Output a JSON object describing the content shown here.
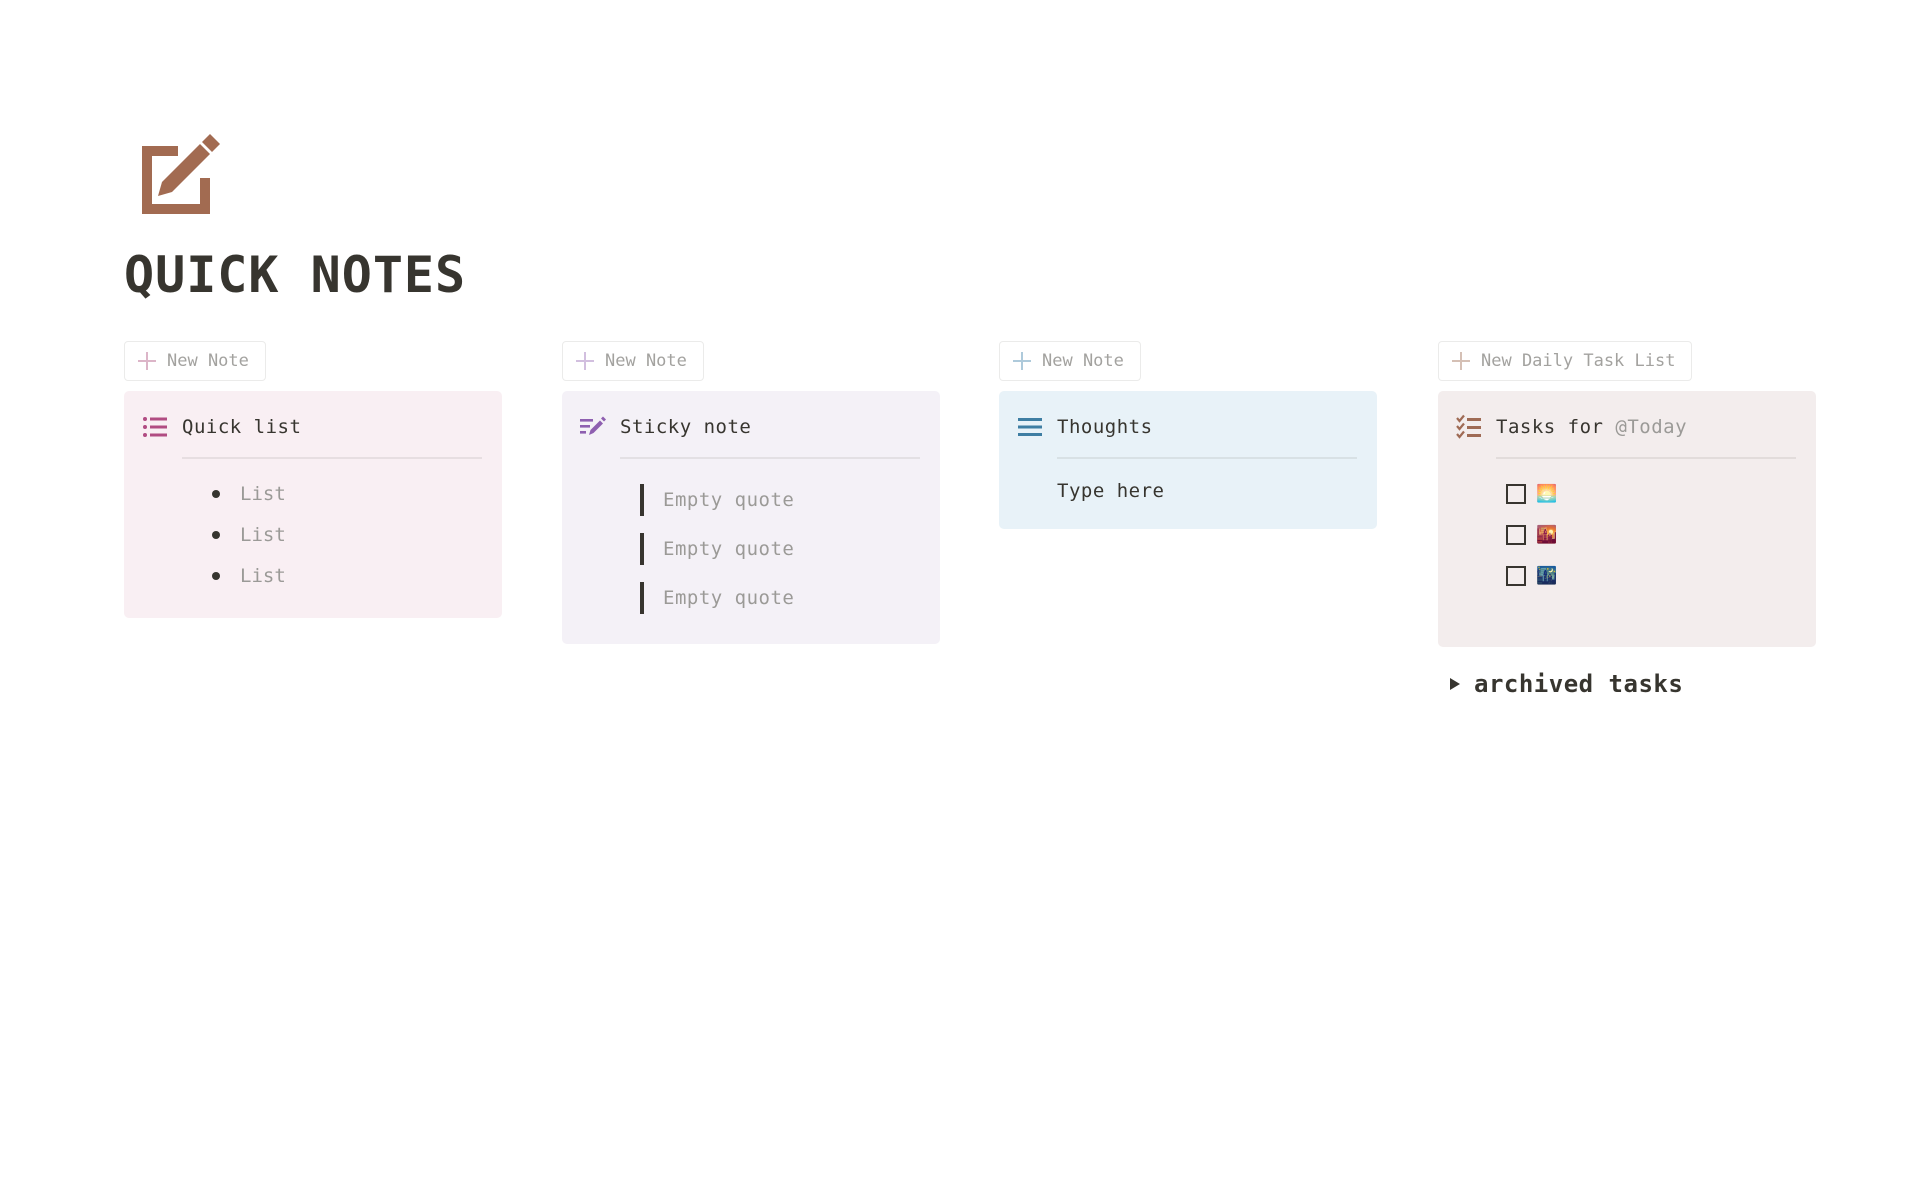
{
  "page": {
    "icon": "edit-square-icon",
    "title": "QUICK NOTES",
    "icon_color": "#a26b51"
  },
  "columns": [
    {
      "new_button": {
        "label": "New Note",
        "plus_color": "#dcb5c8"
      },
      "card": {
        "icon": "bulleted-list-icon",
        "icon_color": "#b14c82",
        "title": "Quick list",
        "items": [
          "List",
          "List",
          "List"
        ]
      }
    },
    {
      "new_button": {
        "label": "New Note",
        "plus_color": "#d2bfdf"
      },
      "card": {
        "icon": "note-edit-icon",
        "icon_color": "#8e5fb0",
        "title": "Sticky note",
        "quotes": [
          "Empty quote",
          "Empty quote",
          "Empty quote"
        ]
      }
    },
    {
      "new_button": {
        "label": "New Note",
        "plus_color": "#aecadb"
      },
      "card": {
        "icon": "text-lines-icon",
        "icon_color": "#3e7ea3",
        "title": "Thoughts",
        "body": "Type here"
      }
    },
    {
      "new_button": {
        "label": "New Daily Task List",
        "plus_color": "#d5c0b5"
      },
      "card": {
        "icon": "checklist-icon",
        "icon_color": "#9f6b55",
        "title": "Tasks for",
        "mention": "@Today",
        "todos": [
          {
            "checked": false,
            "emoji": "🌅"
          },
          {
            "checked": false,
            "emoji": "🌇"
          },
          {
            "checked": false,
            "emoji": "🌃"
          }
        ]
      }
    }
  ],
  "toggle": {
    "label": "archived tasks",
    "expanded": false
  }
}
